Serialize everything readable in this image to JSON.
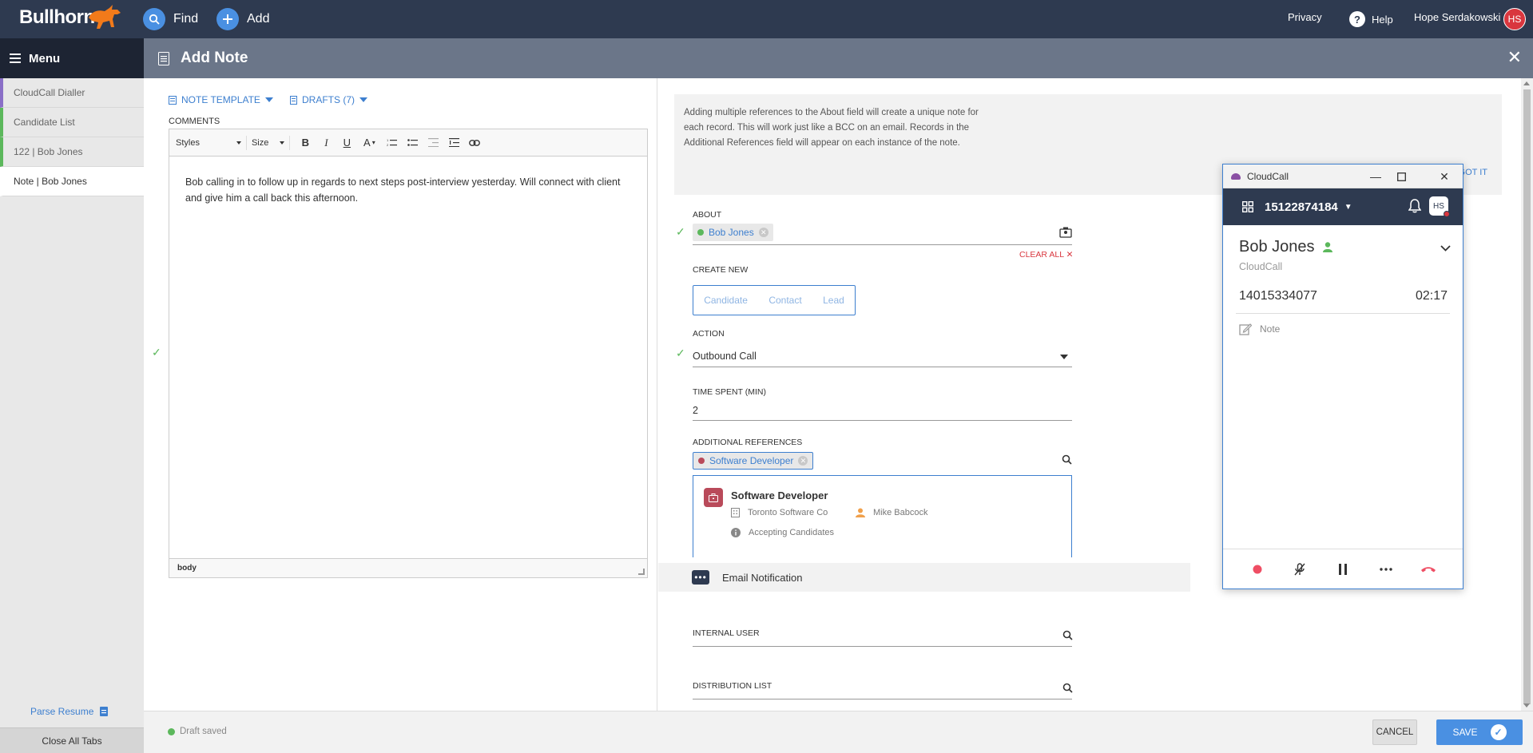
{
  "topbar": {
    "logo": "Bullhorn",
    "find_label": "Find",
    "add_label": "Add",
    "privacy_label": "Privacy",
    "help_label": "Help",
    "user_name": "Hope Serdakowski",
    "user_initials": "HS"
  },
  "sidebar": {
    "menu_label": "Menu",
    "items": [
      {
        "label": "CloudCall Dialler",
        "color": "#8a6fc7"
      },
      {
        "label": "Candidate List",
        "color": "#5cb85c"
      },
      {
        "label": "122 | Bob Jones",
        "color": "#5cb85c"
      },
      {
        "label": "Note | Bob Jones",
        "color": "#ffffff"
      }
    ],
    "parse_resume": "Parse Resume",
    "close_all_tabs": "Close All Tabs"
  },
  "page": {
    "title": "Add Note"
  },
  "editor": {
    "note_template": "NOTE TEMPLATE",
    "drafts": "DRAFTS (7)",
    "comments_label": "COMMENTS",
    "styles_label": "Styles",
    "size_label": "Size",
    "body_text": "Bob calling in to follow up in regards to next steps post-interview yesterday. Will connect with client and give him a call back this afternoon.",
    "status_path": "body"
  },
  "form": {
    "info_text": "Adding multiple references to the About field will create a unique note for each record. This will work just like a BCC on an email. Records in the Additional References field will appear on each instance of the note.",
    "got_it": "GOT IT",
    "about_label": "ABOUT",
    "about_chip": "Bob Jones",
    "clear_all": "CLEAR ALL",
    "create_new_label": "CREATE NEW",
    "create_options": [
      "Candidate",
      "Contact",
      "Lead"
    ],
    "action_label": "ACTION",
    "action_value": "Outbound Call",
    "time_spent_label": "TIME SPENT (MIN)",
    "time_spent_value": "2",
    "additional_refs_label": "ADDITIONAL REFERENCES",
    "ref_chip": "Software Developer",
    "ref_card": {
      "title": "Software Developer",
      "company": "Toronto Software Co",
      "contact": "Mike Babcock",
      "status": "Accepting Candidates"
    },
    "email_notification": "Email Notification",
    "internal_user_label": "INTERNAL USER",
    "distribution_list_label": "DISTRIBUTION LIST"
  },
  "footer": {
    "draft_status": "Draft saved",
    "cancel_label": "CANCEL",
    "save_label": "SAVE"
  },
  "cloudcall": {
    "window_title": "CloudCall",
    "dial_number": "15122874184",
    "initials": "HS",
    "contact_name": "Bob Jones",
    "contact_source": "CloudCall",
    "phone": "14015334077",
    "timer": "02:17",
    "note_label": "Note"
  }
}
